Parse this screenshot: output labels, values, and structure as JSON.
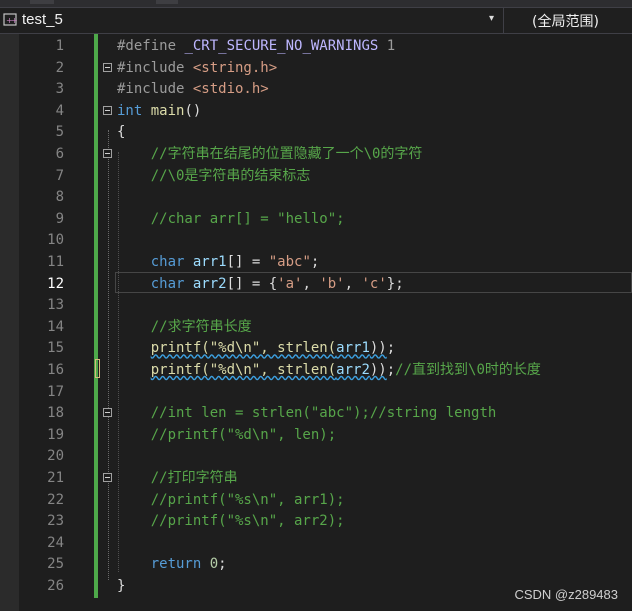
{
  "navbar": {
    "project_name": "test_5",
    "dropdown_arrow": "▾",
    "scope": "(全局范围)"
  },
  "editor": {
    "current_line": 12,
    "lines": [
      {
        "n": "1",
        "tokens": [
          {
            "t": "#define ",
            "c": "pp"
          },
          {
            "t": "_CRT_SECURE_NO_WARNINGS",
            "c": "macro"
          },
          {
            "t": " 1",
            "c": "pp"
          }
        ]
      },
      {
        "n": "2",
        "fold": true,
        "tokens": [
          {
            "t": "#include ",
            "c": "pp"
          },
          {
            "t": "<string.h>",
            "c": "s"
          }
        ]
      },
      {
        "n": "3",
        "tokens": [
          {
            "t": "#include ",
            "c": "pp"
          },
          {
            "t": "<stdio.h>",
            "c": "s"
          }
        ]
      },
      {
        "n": "4",
        "fold": true,
        "tokens": [
          {
            "t": "int",
            "c": "k"
          },
          {
            "t": " "
          },
          {
            "t": "main",
            "c": "fn"
          },
          {
            "t": "()"
          }
        ]
      },
      {
        "n": "5",
        "tokens": [
          {
            "t": "{"
          }
        ]
      },
      {
        "n": "6",
        "fold": true,
        "tokens": [
          {
            "t": "    "
          },
          {
            "t": "//字符串在结尾的位置隐藏了一个\\0的字符",
            "c": "c"
          }
        ]
      },
      {
        "n": "7",
        "tokens": [
          {
            "t": "    "
          },
          {
            "t": "//\\0是字符串的结束标志",
            "c": "c"
          }
        ]
      },
      {
        "n": "8",
        "tokens": []
      },
      {
        "n": "9",
        "tokens": [
          {
            "t": "    "
          },
          {
            "t": "//char arr[] = \"hello\";",
            "c": "c"
          }
        ]
      },
      {
        "n": "10",
        "tokens": []
      },
      {
        "n": "11",
        "tokens": [
          {
            "t": "    "
          },
          {
            "t": "char",
            "c": "k"
          },
          {
            "t": " "
          },
          {
            "t": "arr1",
            "c": "v"
          },
          {
            "t": "[] = "
          },
          {
            "t": "\"abc\"",
            "c": "s"
          },
          {
            "t": ";"
          }
        ]
      },
      {
        "n": "12",
        "tokens": [
          {
            "t": "    "
          },
          {
            "t": "char",
            "c": "k"
          },
          {
            "t": " "
          },
          {
            "t": "arr2",
            "c": "v"
          },
          {
            "t": "[] = {"
          },
          {
            "t": "'a'",
            "c": "s"
          },
          {
            "t": ", "
          },
          {
            "t": "'b'",
            "c": "s"
          },
          {
            "t": ", "
          },
          {
            "t": "'c'",
            "c": "s"
          },
          {
            "t": "};"
          }
        ]
      },
      {
        "n": "13",
        "tokens": []
      },
      {
        "n": "14",
        "tokens": [
          {
            "t": "    "
          },
          {
            "t": "//求字符串长度",
            "c": "c"
          }
        ]
      },
      {
        "n": "15",
        "tokens": [
          {
            "t": "    "
          },
          {
            "t": "printf(\"%d\\n\", strlen(",
            "c": "fn wavy"
          },
          {
            "t": "arr1",
            "c": "v wavy"
          },
          {
            "t": "))",
            "c": "wavy"
          },
          {
            "t": ";"
          }
        ]
      },
      {
        "n": "16",
        "tokens": [
          {
            "t": "    "
          },
          {
            "t": "printf(\"%d\\n\", strlen(",
            "c": "fn wavy"
          },
          {
            "t": "arr2",
            "c": "v wavy"
          },
          {
            "t": "))",
            "c": "wavy"
          },
          {
            "t": ";"
          },
          {
            "t": "//直到找到\\0时的长度",
            "c": "c"
          }
        ]
      },
      {
        "n": "17",
        "tokens": []
      },
      {
        "n": "18",
        "fold": true,
        "tokens": [
          {
            "t": "    "
          },
          {
            "t": "//int len = strlen(\"abc\");//string length",
            "c": "c"
          }
        ]
      },
      {
        "n": "19",
        "tokens": [
          {
            "t": "    "
          },
          {
            "t": "//printf(\"%d\\n\", len);",
            "c": "c"
          }
        ]
      },
      {
        "n": "20",
        "tokens": []
      },
      {
        "n": "21",
        "fold": true,
        "tokens": [
          {
            "t": "    "
          },
          {
            "t": "//打印字符串",
            "c": "c"
          }
        ]
      },
      {
        "n": "22",
        "tokens": [
          {
            "t": "    "
          },
          {
            "t": "//printf(\"%s\\n\", arr1);",
            "c": "c"
          }
        ]
      },
      {
        "n": "23",
        "tokens": [
          {
            "t": "    "
          },
          {
            "t": "//printf(\"%s\\n\", arr2);",
            "c": "c"
          }
        ]
      },
      {
        "n": "24",
        "tokens": []
      },
      {
        "n": "25",
        "tokens": [
          {
            "t": "    "
          },
          {
            "t": "return",
            "c": "k"
          },
          {
            "t": " "
          },
          {
            "t": "0",
            "c": "n"
          },
          {
            "t": ";"
          }
        ]
      },
      {
        "n": "26",
        "tokens": [
          {
            "t": "}"
          }
        ]
      }
    ]
  },
  "watermark": "CSDN @z289483"
}
